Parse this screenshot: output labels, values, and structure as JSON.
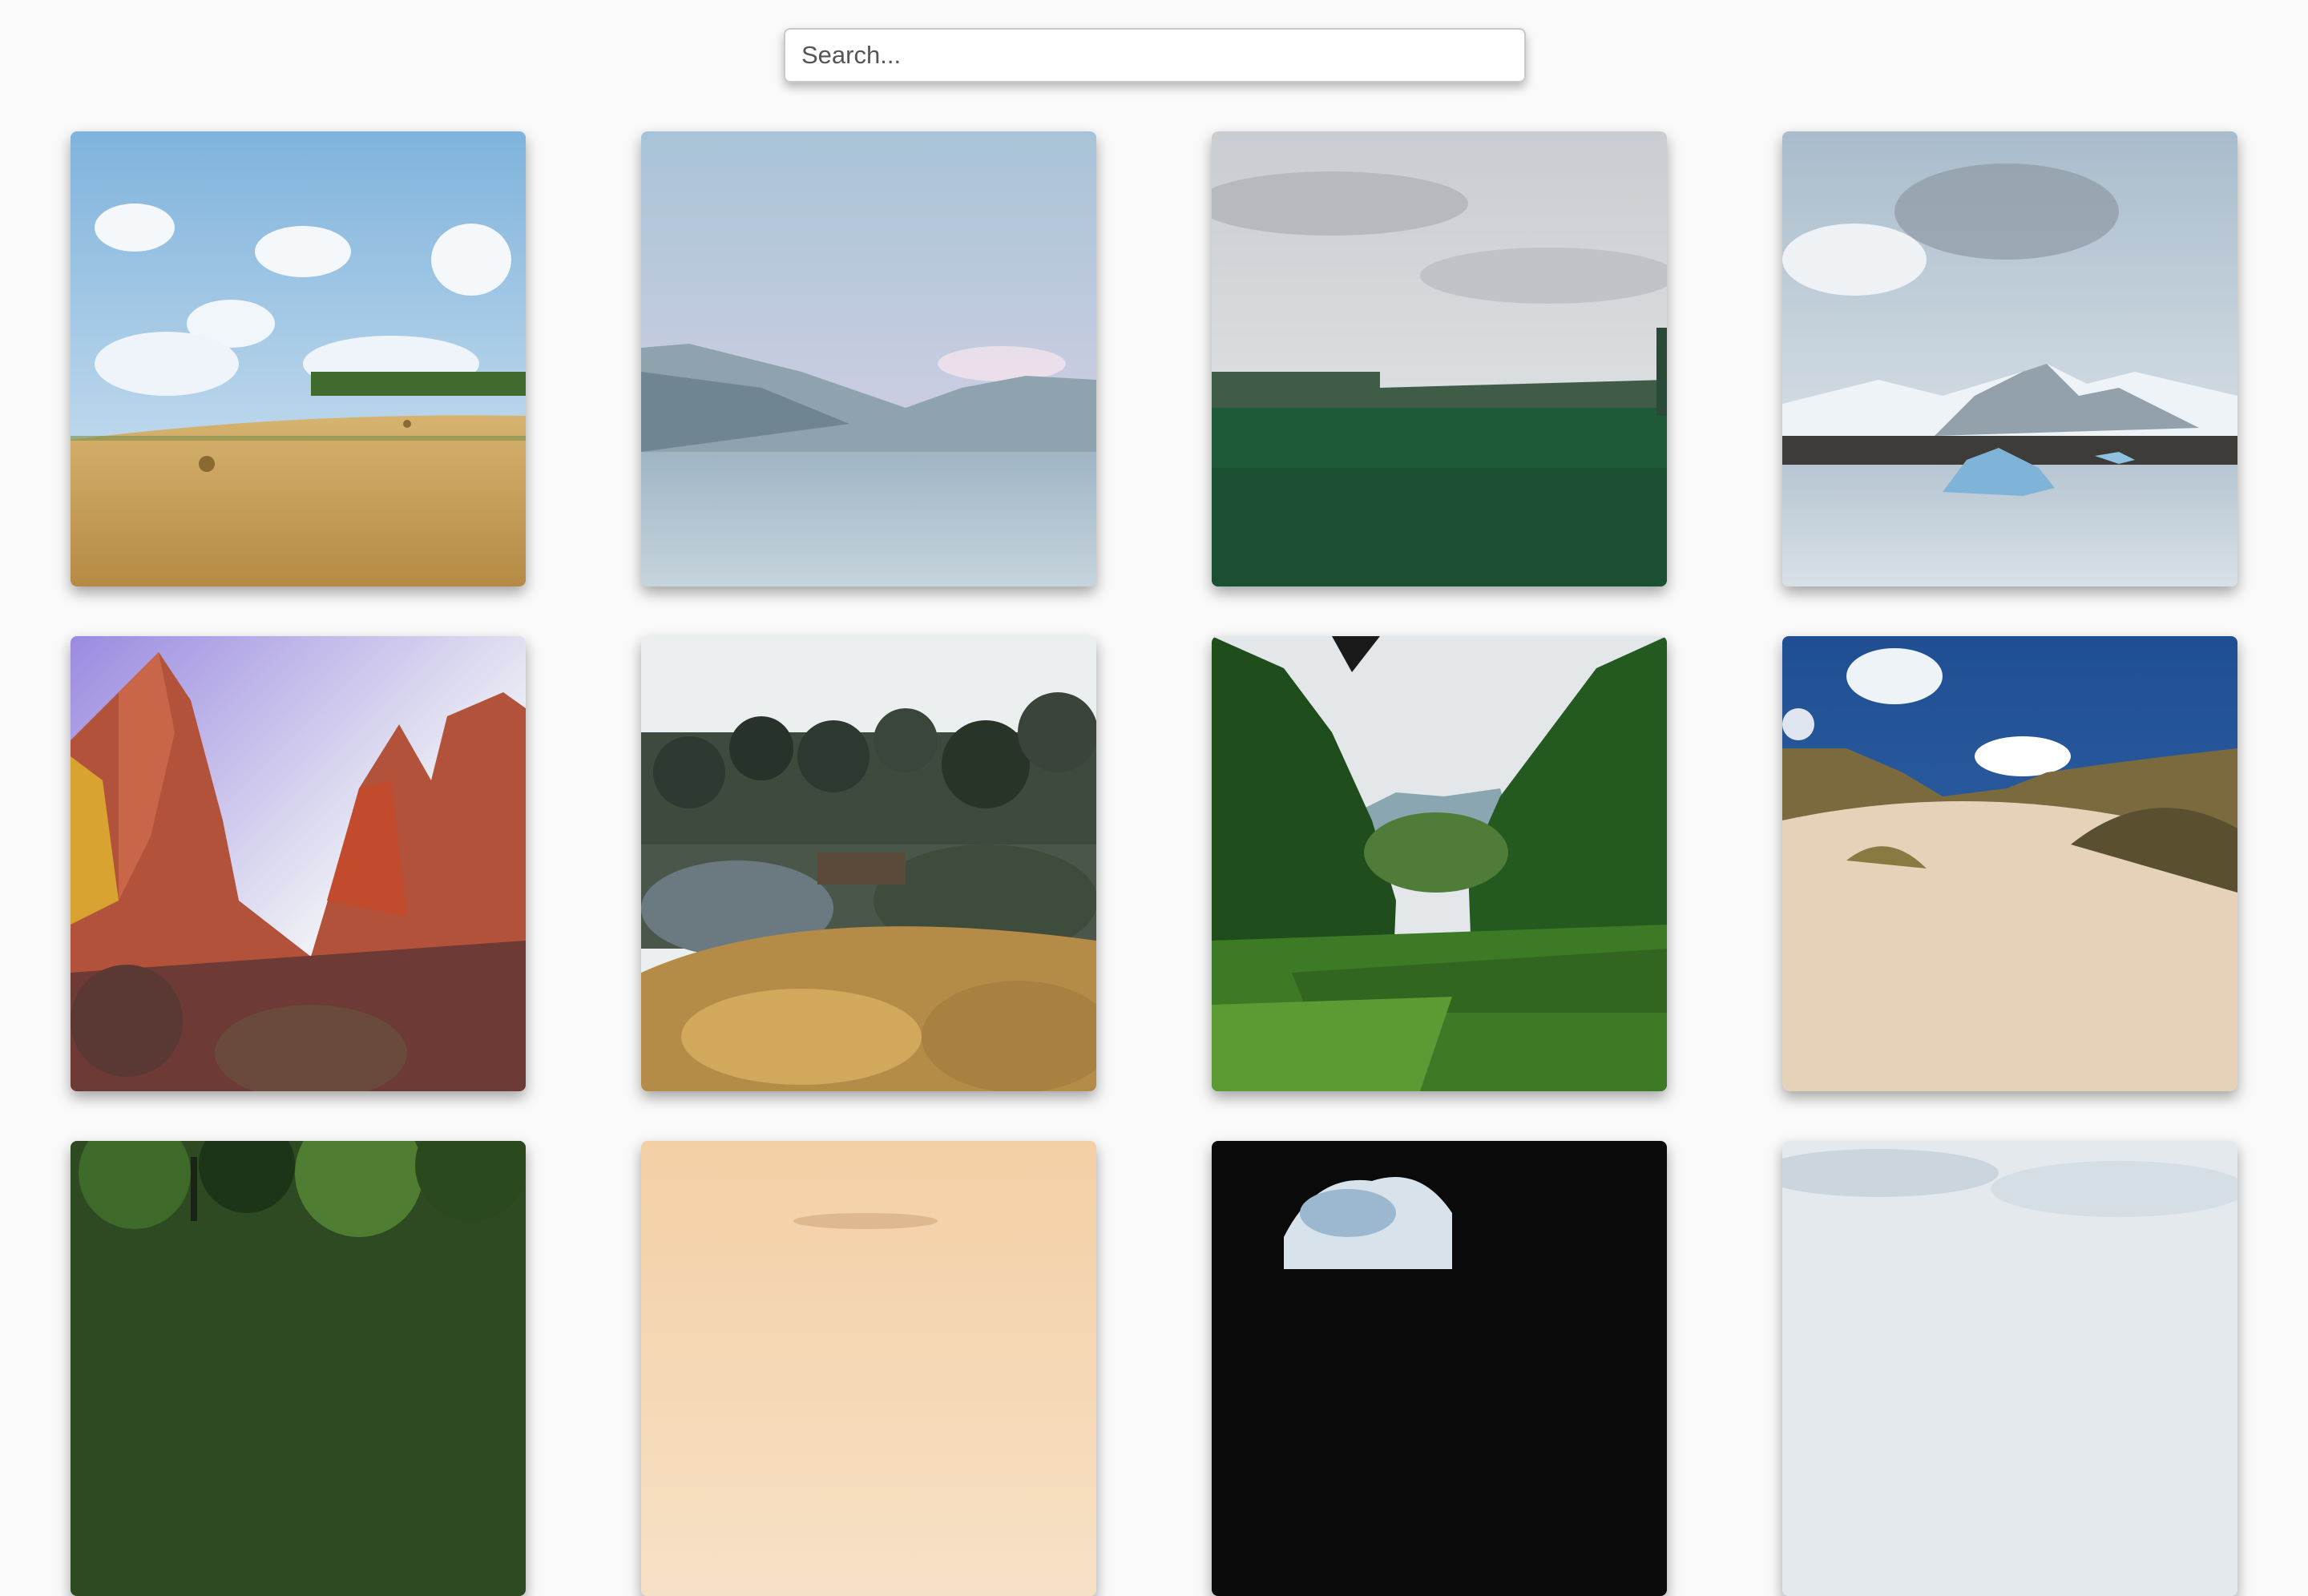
{
  "search": {
    "placeholder": "Search...",
    "value": ""
  },
  "gallery": {
    "tiles": [
      {
        "name": "wheat-field-hay-bales-image"
      },
      {
        "name": "mountain-lake-image"
      },
      {
        "name": "green-forest-plain-image"
      },
      {
        "name": "glacier-icebergs-image"
      },
      {
        "name": "red-rock-canyon-image"
      },
      {
        "name": "garden-trees-image"
      },
      {
        "name": "jungle-valley-image"
      },
      {
        "name": "sand-dunes-image"
      },
      {
        "name": "forest-canopy-image"
      },
      {
        "name": "peach-sky-image"
      },
      {
        "name": "dark-cave-opening-image"
      },
      {
        "name": "cloudy-sky-image"
      }
    ]
  }
}
